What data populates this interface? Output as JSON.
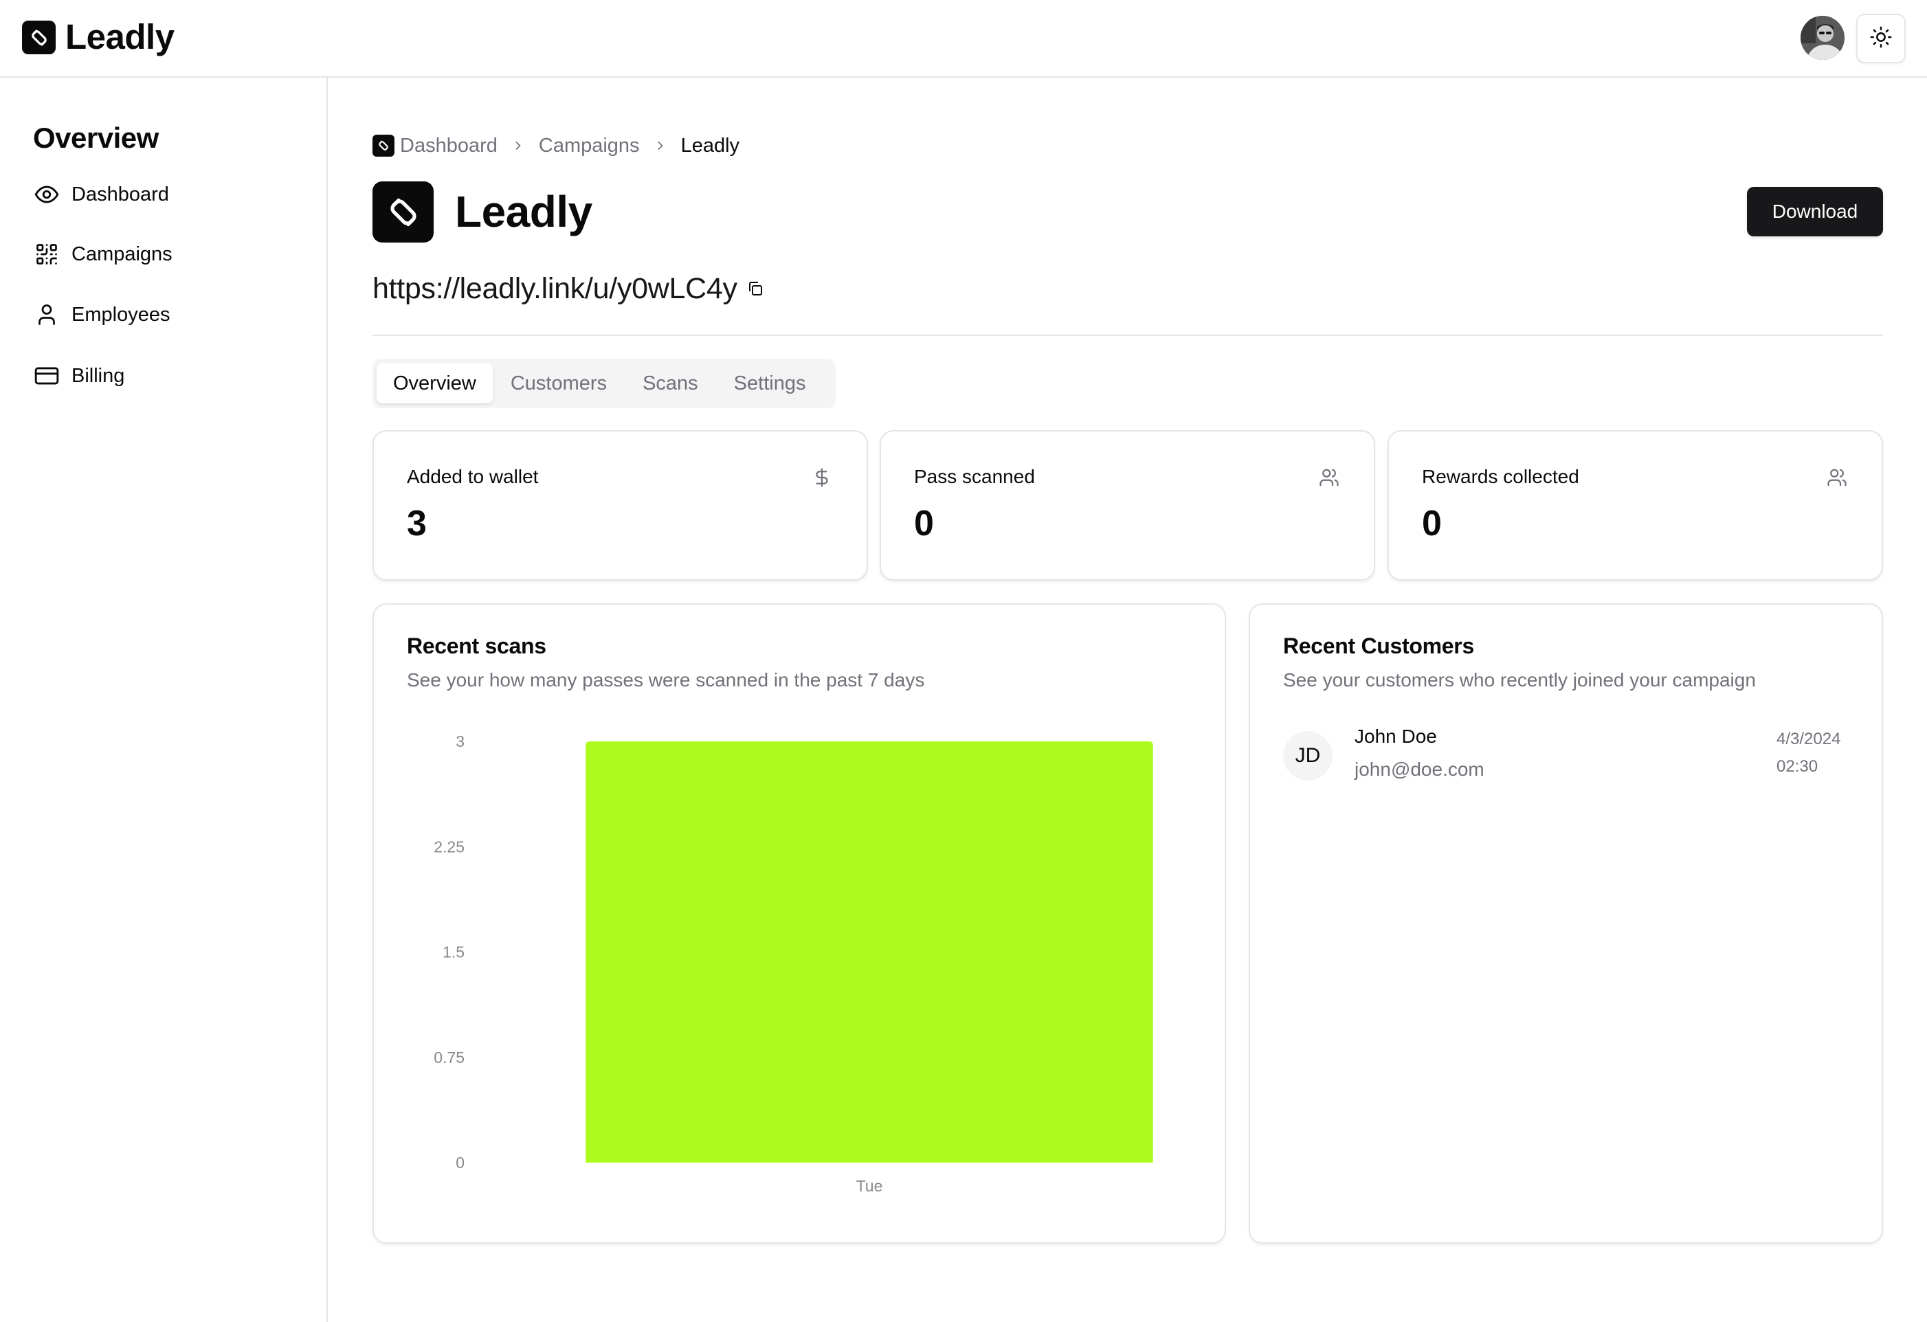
{
  "app": {
    "name": "Leadly"
  },
  "header": {
    "avatar_alt": "User avatar",
    "theme_toggle_label": "Toggle theme"
  },
  "sidebar": {
    "title": "Overview",
    "items": [
      {
        "label": "Dashboard",
        "icon": "eye-icon"
      },
      {
        "label": "Campaigns",
        "icon": "qr-code-icon"
      },
      {
        "label": "Employees",
        "icon": "user-icon"
      },
      {
        "label": "Billing",
        "icon": "credit-card-icon"
      }
    ]
  },
  "breadcrumb": [
    {
      "label": "Dashboard"
    },
    {
      "label": "Campaigns"
    },
    {
      "label": "Leadly"
    }
  ],
  "campaign": {
    "title": "Leadly",
    "url": "https://leadly.link/u/y0wLC4y",
    "download_label": "Download"
  },
  "tabs": [
    {
      "label": "Overview",
      "active": true
    },
    {
      "label": "Customers",
      "active": false
    },
    {
      "label": "Scans",
      "active": false
    },
    {
      "label": "Settings",
      "active": false
    }
  ],
  "stats": [
    {
      "label": "Added to wallet",
      "value": "3",
      "icon": "dollar-icon"
    },
    {
      "label": "Pass scanned",
      "value": "0",
      "icon": "users-icon"
    },
    {
      "label": "Rewards collected",
      "value": "0",
      "icon": "users-icon"
    }
  ],
  "recent_scans": {
    "title": "Recent scans",
    "subtitle": "See your how many passes were scanned in the past 7 days"
  },
  "chart_data": {
    "type": "bar",
    "title": "Recent scans",
    "categories": [
      "Tue"
    ],
    "values": [
      3
    ],
    "xlabel": "",
    "ylabel": "",
    "ylim": [
      0,
      3
    ],
    "yticks": [
      "0",
      "0.75",
      "1.5",
      "2.25",
      "3"
    ],
    "ytick_values": [
      0,
      0.75,
      1.5,
      2.25,
      3
    ],
    "grid": false,
    "legend": "none",
    "bar_color": "#adfa1d"
  },
  "recent_customers": {
    "title": "Recent Customers",
    "subtitle": "See your customers who recently joined your campaign",
    "items": [
      {
        "initials": "JD",
        "name": "John Doe",
        "email": "john@doe.com",
        "date": "4/3/2024",
        "time": "02:30"
      }
    ]
  },
  "colors": {
    "accent": "#adfa1d",
    "primary": "#18181b",
    "muted": "#71717a",
    "border": "#e5e5e5"
  }
}
